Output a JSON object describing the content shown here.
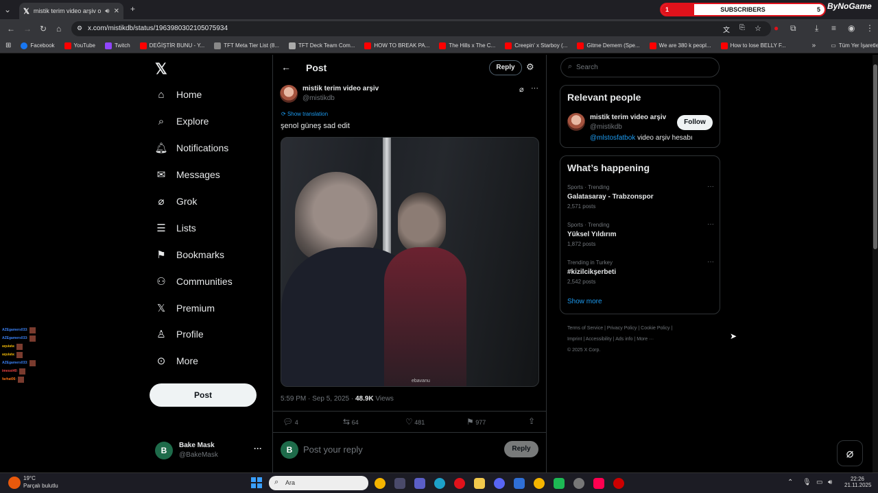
{
  "browser": {
    "tab_title": "mistik terim video arşiv on",
    "url": "x.com/mistikdb/status/1963980302105075934",
    "bookmarks": [
      "Facebook",
      "YouTube",
      "Twitch",
      "DEĞİŞTİR BUNU - Y...",
      "TFT Meta Tier List (8...",
      "TFT Deck Team Com...",
      "HOW TO BREAK PA...",
      "The Hills x The C...",
      "Creepin' x Starboy (...",
      "Gitme Demem (Spe...",
      "We are 380 k peopl...",
      "How to lose BELLY F..."
    ],
    "all_bookmarks": "Tüm Yer İşaretleri",
    "subscribers": {
      "left": "1",
      "label": "SUBSCRIBERS",
      "right": "5",
      "progress": 0.2
    },
    "brand": "ByNoGame"
  },
  "nav": {
    "items": [
      "Home",
      "Explore",
      "Notifications",
      "Messages",
      "Grok",
      "Lists",
      "Bookmarks",
      "Communities",
      "Premium",
      "Profile",
      "More"
    ],
    "post_button": "Post",
    "account_name": "Bake Mask",
    "account_handle": "@BakeMask",
    "account_initial": "B"
  },
  "main": {
    "header": "Post",
    "reply_button": "Reply",
    "author_name": "mistik terim video arşiv",
    "author_handle": "@mistikdb",
    "show_translation": "Show translation",
    "text": "şenol güneş sad edit",
    "watermark": "ebavanu",
    "time": "5:59 PM · Sep 5, 2025 · ",
    "views_count": "48.9K",
    "views_label": " Views",
    "replies": "4",
    "reposts": "64",
    "likes": "481",
    "bookmarks": "977",
    "reply_placeholder": "Post your reply",
    "reply_submit": "Reply",
    "reply_avatar": "B"
  },
  "sidebar": {
    "search_placeholder": "Search",
    "relevant_title": "Relevant people",
    "person_name": "mistik terim video arşiv",
    "person_handle": "@mistikdb",
    "follow": "Follow",
    "bio_link": "@mlstosfatbok",
    "bio_text": " video arşiv hesabı",
    "happening_title": "What’s happening",
    "trends": [
      {
        "context": "Sports · Trending",
        "name": "Galatasaray - Trabzonspor",
        "posts": "2,571 posts"
      },
      {
        "context": "Sports · Trending",
        "name": "Yüksel Yıldırım",
        "posts": "1,872 posts"
      },
      {
        "context": "Trending in Turkey",
        "name": "#kizilcikşerbeti",
        "posts": "2,542 posts"
      }
    ],
    "show_more": "Show more",
    "footer": [
      "Terms of Service",
      "Privacy Policy",
      "Cookie Policy",
      "Imprint",
      "Accessibility",
      "Ads info",
      "More ···"
    ],
    "copyright": "© 2025 X Corp."
  },
  "chat": [
    {
      "user": "AZEgamers033",
      "color": "#3b82f6"
    },
    {
      "user": "AZEgamers033",
      "color": "#3b82f6"
    },
    {
      "user": "aquiata",
      "color": "#eab308"
    },
    {
      "user": "aquiata",
      "color": "#eab308"
    },
    {
      "user": "AZEgamers033",
      "color": "#3b82f6"
    },
    {
      "user": "imesst40",
      "color": "#ef4444"
    },
    {
      "user": "farhat06",
      "color": "#f97316"
    }
  ],
  "taskbar": {
    "temp": "19°C",
    "weather": "Parçalı bulutlu",
    "search": "Ara",
    "time": "22:26",
    "date": "21.11.2025"
  }
}
